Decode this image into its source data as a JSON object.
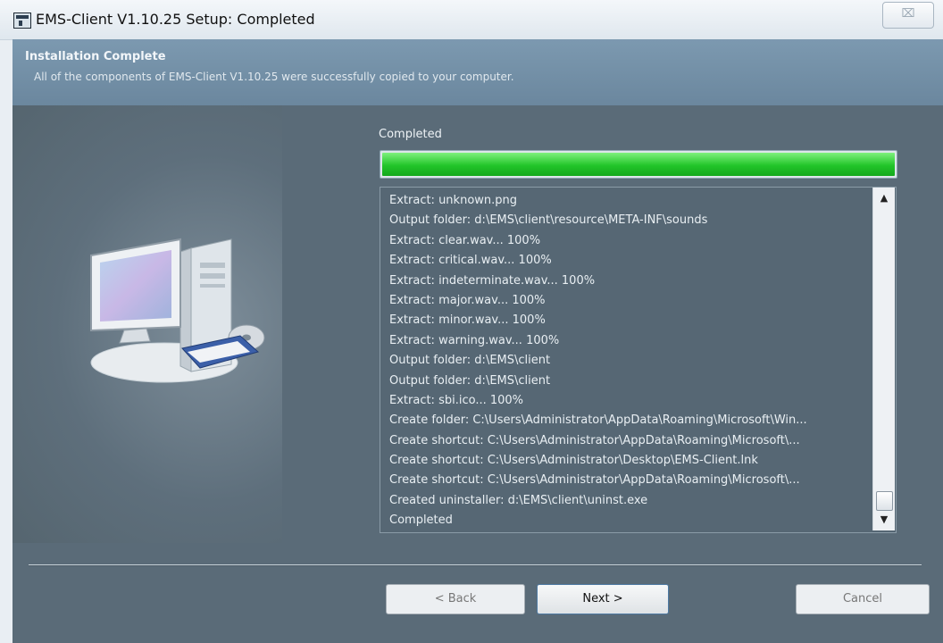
{
  "window": {
    "title": "EMS-Client V1.10.25 Setup: Completed",
    "close_glyph": "⌧"
  },
  "header": {
    "title": "Installation Complete",
    "subtitle": "All of the components of EMS-Client V1.10.25 were successfully copied to your computer."
  },
  "status": {
    "label": "Completed",
    "progress_fraction": 1.0
  },
  "log": {
    "lines": [
      "Extract: unknown.png",
      "Output folder: d:\\EMS\\client\\resource\\META-INF\\sounds",
      "Extract: clear.wav... 100%",
      "Extract: critical.wav... 100%",
      "Extract: indeterminate.wav... 100%",
      "Extract: major.wav... 100%",
      "Extract: minor.wav... 100%",
      "Extract: warning.wav... 100%",
      "Output folder: d:\\EMS\\client",
      "Output folder: d:\\EMS\\client",
      "Extract: sbi.ico... 100%",
      "Create folder: C:\\Users\\Administrator\\AppData\\Roaming\\Microsoft\\Win...",
      "Create shortcut: C:\\Users\\Administrator\\AppData\\Roaming\\Microsoft\\...",
      "Create shortcut: C:\\Users\\Administrator\\Desktop\\EMS-Client.lnk",
      "Create shortcut: C:\\Users\\Administrator\\AppData\\Roaming\\Microsoft\\...",
      "Created uninstaller: d:\\EMS\\client\\uninst.exe",
      "Completed"
    ]
  },
  "buttons": {
    "back": "< Back",
    "next": "Next >",
    "cancel": "Cancel"
  },
  "icons": {
    "app": "installer-app-icon",
    "art": "computer-install-illustration",
    "scroll_up": "▲",
    "scroll_down": "▼"
  },
  "colors": {
    "progress_green": "#22c52a",
    "header_bg": "#7c99b0",
    "body_bg": "#5a6b78"
  }
}
